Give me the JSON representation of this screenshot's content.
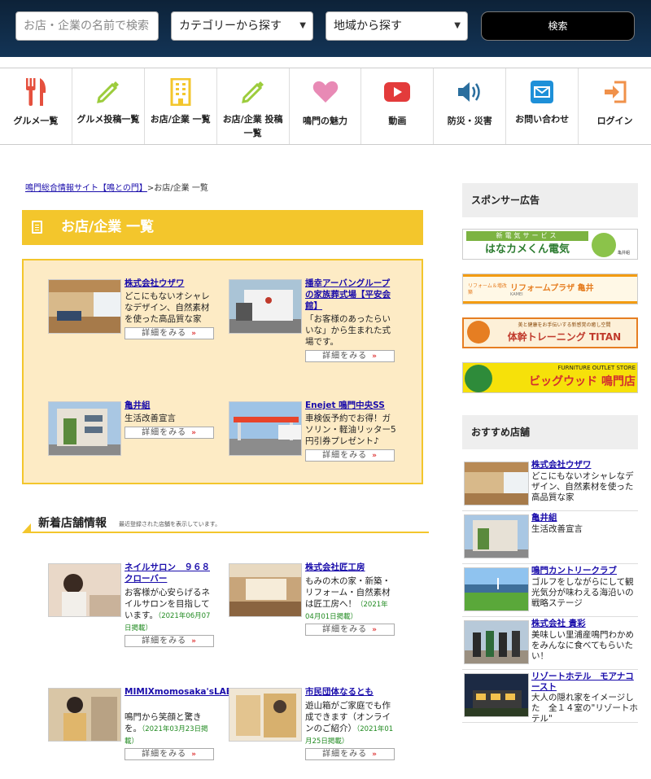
{
  "search": {
    "placeholder": "お店・企業の名前で検索",
    "category_label": "カテゴリーから探す",
    "area_label": "地域から探す",
    "button_label": "検索"
  },
  "nav": [
    {
      "label": "グルメ一覧",
      "icon": "fork-knife-icon",
      "color": "#e5503e"
    },
    {
      "label": "グルメ投稿一覧",
      "icon": "pencil-icon",
      "color": "#9ccc3c"
    },
    {
      "label": "お店/企業 一覧",
      "icon": "building-icon",
      "color": "#f3c62c"
    },
    {
      "label": "お店/企業 投稿一覧",
      "icon": "pencil-icon",
      "color": "#9ccc3c"
    },
    {
      "label": "鳴門の魅力",
      "icon": "heart-icon",
      "color": "#e88ab5"
    },
    {
      "label": "動画",
      "icon": "youtube-icon",
      "color": "#e33b3b"
    },
    {
      "label": "防災・災害",
      "icon": "speaker-icon",
      "color": "#2a6e9e"
    },
    {
      "label": "お問い合わせ",
      "icon": "mail-icon",
      "color": "#1e90d8"
    },
    {
      "label": "ログイン",
      "icon": "login-icon",
      "color": "#f0914a"
    }
  ],
  "breadcrumb": {
    "home": "鳴門総合情報サイト【鳴との門】",
    "sep": ">",
    "current": "お店/企業 一覧"
  },
  "section_title": "お店/企業 一覧",
  "featured": [
    {
      "title": "株式会社ウザワ",
      "desc": "どこにもないオシャレなデザイン、自然素材を使った高品質な家",
      "more": "詳細をみる"
    },
    {
      "title": "播幸アーバングループの家族葬式場【平安会館】",
      "desc": "「お客様のあったらいいな」から生まれた式場です。",
      "more": "詳細をみる"
    },
    {
      "title": "亀井組",
      "desc": "生活改善宣言",
      "more": "詳細をみる"
    },
    {
      "title": "Enejet 鳴門中央SS",
      "desc": "車検仮予約でお得！ガソリン・軽油リッター5円引券プレゼント♪",
      "more": "詳細をみる"
    }
  ],
  "new_section": {
    "title": "新着店舗情報",
    "subtitle": "最近登録された店舗を表示しています。"
  },
  "new_shops": [
    {
      "title": "ネイルサロン　９６８クローバー",
      "desc": "お客様が心安らげるネイルサロンを目指しています。",
      "date": "（2021年06月07日掲載）",
      "more": "詳細をみる"
    },
    {
      "title": "株式会社匠工房",
      "desc": "もみの木の家・新築・リフォーム・自然素材は匠工房へ！",
      "date": "（2021年04月01日掲載）",
      "more": "詳細をみる"
    },
    {
      "title": "MIMIXmomosaka'sLABO.",
      "desc": "鳴門から笑顔と驚きを。",
      "date": "（2021年03月23日掲載）",
      "more": "詳細をみる"
    },
    {
      "title": "市民団体なるとも",
      "desc": "遊山箱がご家庭でも作成できます（オンラインのご紹介）",
      "date": "（2021年01月25日掲載）",
      "more": "詳細をみる"
    }
  ],
  "sidebar": {
    "sponsor_title": "スポンサー広告",
    "banners": [
      {
        "top": "新電気サービス",
        "main": "はなカメくん電気",
        "sub": "亀井組"
      },
      {
        "top": "リフォーム＆増改築",
        "main": "リフォームプラザ 亀井",
        "sub": "KAMEI"
      },
      {
        "top": "美と健康をお手伝いする新感覚の癒し空間",
        "main": "体幹トレーニング TITAN",
        "sub": ""
      },
      {
        "top": "FURNITURE OUTLET STORE",
        "main": "ビッグウッド 鳴門店",
        "sub": ""
      }
    ],
    "recommend_title": "おすすめ店舗",
    "recommend": [
      {
        "title": "株式会社ウザワ",
        "desc": "どこにもないオシャレなデザイン、自然素材を使った高品質な家"
      },
      {
        "title": "亀井組",
        "desc": "生活改善宣言"
      },
      {
        "title": "鳴門カントリークラブ",
        "desc": "ゴルフをしながらにして観光気分が味わえる海沿いの戦略ステージ"
      },
      {
        "title": "株式会社 貴彩",
        "desc": "美味しい里浦産鳴門わかめをみんなに食べてもらいたい！"
      },
      {
        "title": "リゾートホテル　モアナコースト",
        "desc": "大人の隠れ家をイメージした　全１４室の\"リゾートホテル\""
      }
    ]
  }
}
